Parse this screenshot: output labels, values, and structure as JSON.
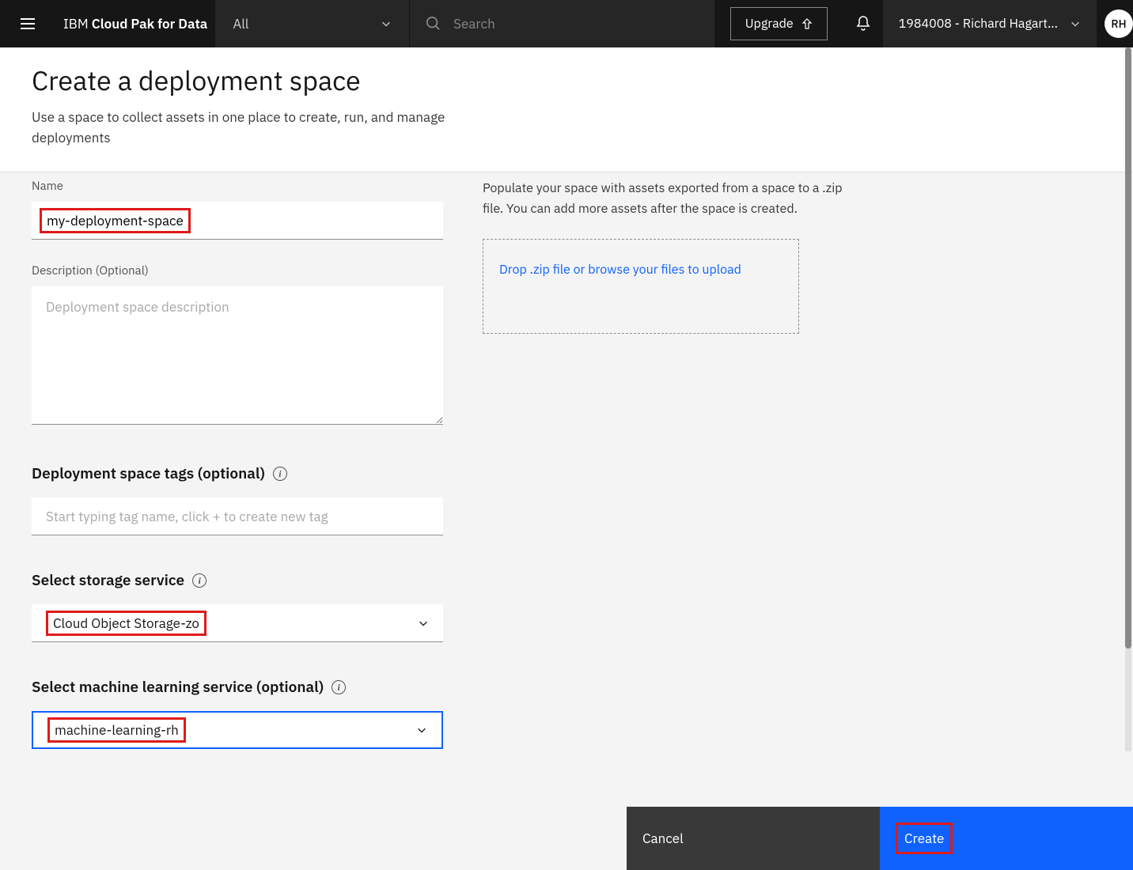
{
  "header": {
    "brand_prefix": "IBM",
    "brand_main": "Cloud Pak for Data",
    "scope": "All",
    "search_placeholder": "Search",
    "upgrade_label": "Upgrade",
    "account_label": "1984008 - Richard Hagart...",
    "avatar_initials": "RH"
  },
  "page": {
    "title": "Create a deployment space",
    "subtitle": "Use a space to collect assets in one place to create, run, and manage deployments"
  },
  "form": {
    "name_label": "Name",
    "name_value": "my-deployment-space",
    "desc_label": "Description (Optional)",
    "desc_placeholder": "Deployment space description",
    "tags_label": "Deployment space tags (optional)",
    "tags_placeholder": "Start typing tag name, click + to create new tag",
    "storage_label": "Select storage service",
    "storage_value": "Cloud Object Storage-zo",
    "ml_label": "Select machine learning service (optional)",
    "ml_value": "machine-learning-rh"
  },
  "upload": {
    "desc": "Populate your space with assets exported from a space to a .zip file. You can add more assets after the space is created.",
    "link": "Drop .zip file or browse your files to upload"
  },
  "footer": {
    "cancel": "Cancel",
    "create": "Create"
  }
}
